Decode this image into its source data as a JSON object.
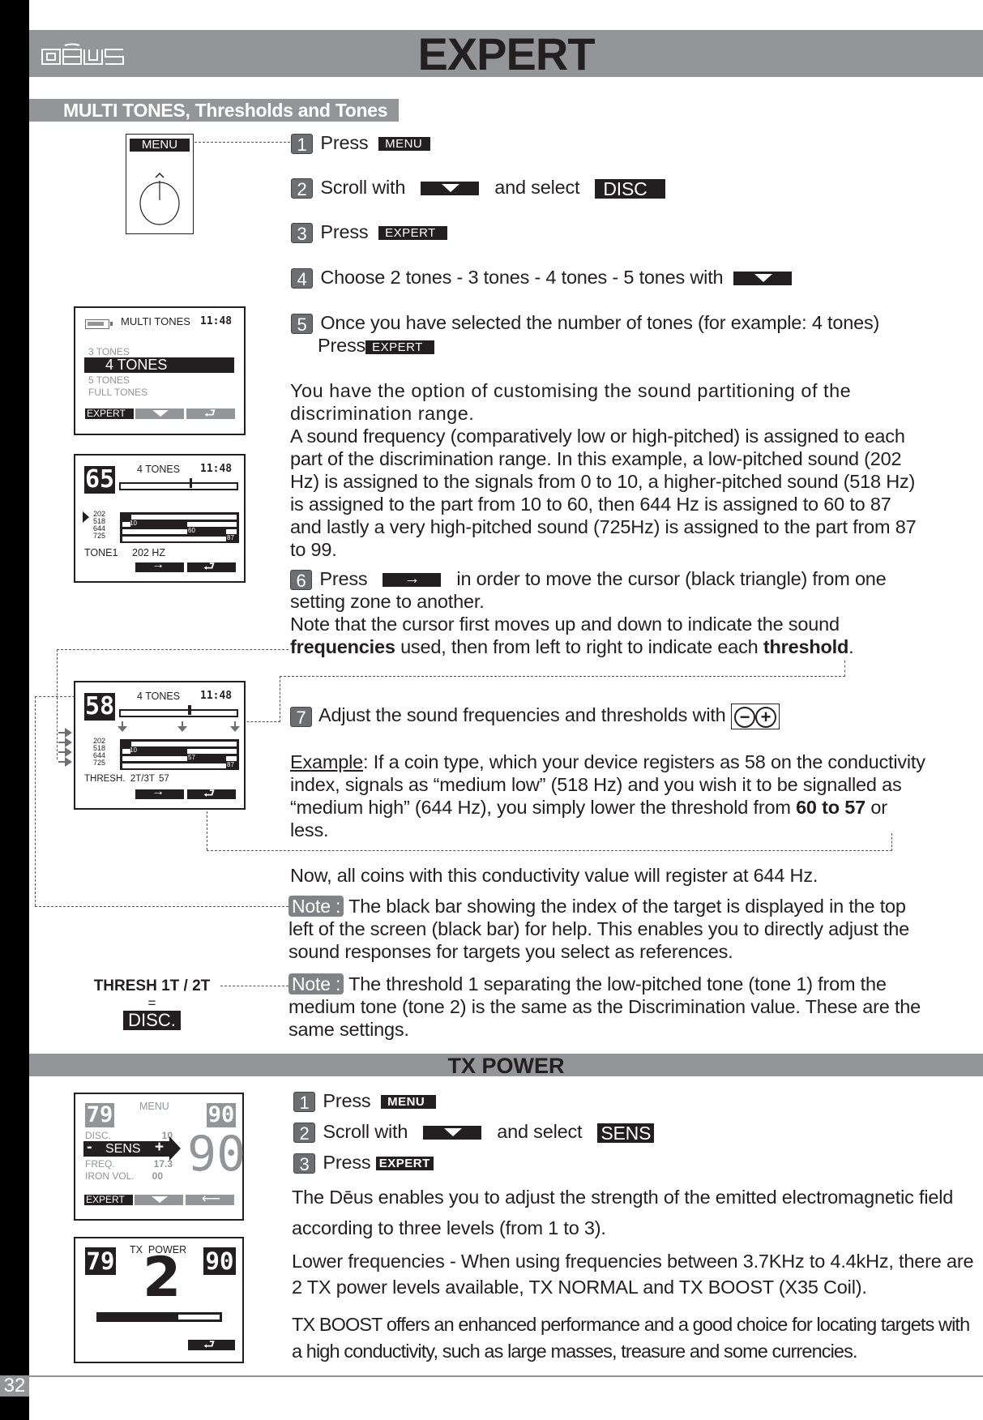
{
  "header": {
    "logo_text": "DĒUS",
    "title": "EXPERT"
  },
  "section_multitones": {
    "title": "MULTI TONES, Thresholds and Tones",
    "menu_device": {
      "label": "MENU"
    },
    "steps": [
      {
        "num": "1",
        "text": "Press",
        "button": "MENU"
      },
      {
        "num": "2",
        "text": "Scroll with",
        "button_icon": "down-arrow",
        "text2": "and select",
        "select": "DISC"
      },
      {
        "num": "3",
        "text": "Press",
        "button": "EXPERT"
      },
      {
        "num": "4",
        "text": "Choose 2 tones - 3 tones - 4 tones - 5 tones with",
        "button_icon": "down-arrow"
      },
      {
        "num": "5",
        "text": "Once you have selected the number of tones (for example: 4 tones)",
        "text2": "Press",
        "button": "EXPERT"
      },
      {
        "num": "6",
        "text": "Press",
        "button_icon": "right-arrow",
        "text2": "in order to move the cursor (black triangle) from one setting zone to another."
      },
      {
        "num": "7",
        "text": "Adjust the sound frequencies and thresholds with"
      }
    ],
    "para_option": "You have the option of customising the sound partitioning of the discrimination range.",
    "para_frequency": "A sound frequency (comparatively low or high-pitched) is assigned to each part of the discrimination range. In this example, a low-pitched sound (202 Hz) is assigned to the signals from 0 to 10, a higher-pitched sound (518 Hz) is assigned to the part from 10 to 60, then 644 Hz is assigned to 60 to 87 and lastly a very high-pitched sound (725Hz) is assigned to the part from 87 to 99.",
    "note_cursor": {
      "pre": "Note that the cursor first moves up and down to indicate the sound",
      "bold1": "frequencies",
      "mid": "used, then from left to right to indicate each",
      "bold2": "threshold",
      "end": "."
    },
    "example": {
      "label": "Example",
      "text": ": If a coin type, which your device registers as 58 on the conductivity index, signals as “medium low” (518 Hz) and you wish it to be signalled as “medium high” (644 Hz), you simply lower the threshold from",
      "bold": "60 to 57",
      "end": "or less."
    },
    "now_text": "Now, all coins with this conductivity value will register at 644 Hz.",
    "note1": {
      "tag": "Note :",
      "text": "The black bar showing the index of the target is displayed in the top left of the screen (black bar) for help. This enables you to directly adjust the sound responses for targets you select as references."
    },
    "note2": {
      "tag": "Note :",
      "text": "The threshold 1 separating the low-pitched tone (tone 1) from the medium tone (tone 2) is the same as the Discrimination value. These are the same settings."
    },
    "thresh_label": {
      "line1": "THRESH 1T / 2T",
      "line2": "=",
      "line3": "DISC."
    }
  },
  "screen_multitones": {
    "title": "MULTI TONES",
    "time": "11:48",
    "options": [
      "3 TONES",
      "4 TONES",
      "5 TONES",
      "FULL TONES"
    ],
    "selected": "4 TONES",
    "buttons": [
      "EXPERT",
      "down",
      "back"
    ]
  },
  "screen_tone1": {
    "index": "65",
    "title": "4 TONES",
    "time": "11:48",
    "freqs": [
      "202",
      "518",
      "644",
      "725"
    ],
    "thresholds": [
      "10",
      "60",
      "87"
    ],
    "status_label": "TONE1",
    "status_value": "202 HZ"
  },
  "screen_thresh": {
    "index": "58",
    "title": "4 TONES",
    "time": "11:48",
    "freqs": [
      "202",
      "518",
      "644",
      "725"
    ],
    "thresholds": [
      "10",
      "57",
      "87"
    ],
    "status_label": "THRESH.  2T/3T",
    "status_value": "57"
  },
  "section_txpower": {
    "title": "TX POWER",
    "steps": [
      {
        "num": "1",
        "text": "Press",
        "button": "MENU"
      },
      {
        "num": "2",
        "text": "Scroll with",
        "text2": "and select",
        "select": "SENS"
      },
      {
        "num": "3",
        "text": "Press",
        "button": "EXPERT"
      }
    ],
    "para1": "The Dēus enables you to adjust the strength of the emitted electromagnetic field according to three levels (from 1 to 3).",
    "para2": "Lower frequencies - When using frequencies between 3.7KHz to 4.4kHz, there are 2 TX power levels available, TX NORMAL and TX BOOST (X35 Coil).",
    "para3": "TX BOOST offers an enhanced performance and a good choice for locating targets with a high conductivity, such as large masses, treasure and some currencies."
  },
  "screen_menu": {
    "left_num": "79",
    "title": "MENU",
    "right_num": "90",
    "big_num": "90",
    "rows": [
      {
        "label": "DISC.",
        "value": "10"
      },
      {
        "label": "SENS",
        "value": ""
      },
      {
        "label": "FREQ.",
        "value": "17.3"
      },
      {
        "label": "IRON VOL.",
        "value": "00"
      }
    ],
    "minus": "-",
    "plus": "+",
    "expert": "EXPERT"
  },
  "screen_txpower": {
    "left_num": "79",
    "title": "TX  POWER",
    "right_num": "90",
    "level": "2",
    "level_fraction": 0.65
  },
  "footer": {
    "page_number": "32"
  }
}
